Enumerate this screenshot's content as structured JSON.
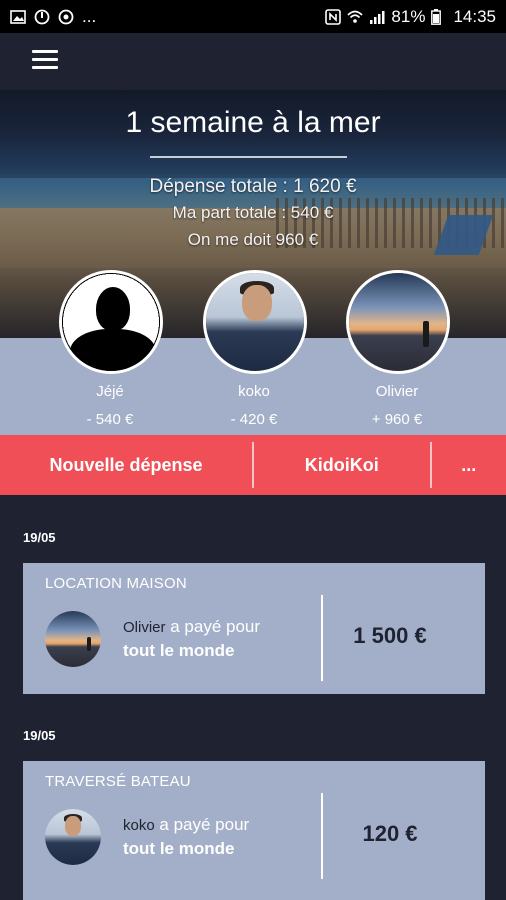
{
  "status_bar": {
    "battery": "81%",
    "time": "14:35",
    "dots": "..."
  },
  "trip": {
    "title": "1 semaine à la mer",
    "total_expense": "Dépense totale : 1 620 €",
    "my_share": "Ma part totale : 540 €",
    "owed_to_me": "On me doit 960 €"
  },
  "members": [
    {
      "name": "Jéjé",
      "balance": "- 540 €"
    },
    {
      "name": "koko",
      "balance": "- 420 €"
    },
    {
      "name": "Olivier",
      "balance": "+ 960 €"
    }
  ],
  "actions": {
    "new_expense": "Nouvelle dépense",
    "kidoikoi": "KidoiKoi",
    "more": "..."
  },
  "expenses": [
    {
      "date": "19/05",
      "title": "LOCATION MAISON",
      "payer": "Olivier",
      "paid_text": "a payé pour",
      "beneficiaries": "tout le monde",
      "amount": "1 500 €"
    },
    {
      "date": "19/05",
      "title": "TRAVERSÉ BATEAU",
      "payer": "koko",
      "paid_text": "a payé pour",
      "beneficiaries": "tout le monde",
      "amount": "120 €"
    }
  ],
  "colors": {
    "background": "#1f2230",
    "panel": "#a3afc8",
    "accent": "#f04f57"
  }
}
